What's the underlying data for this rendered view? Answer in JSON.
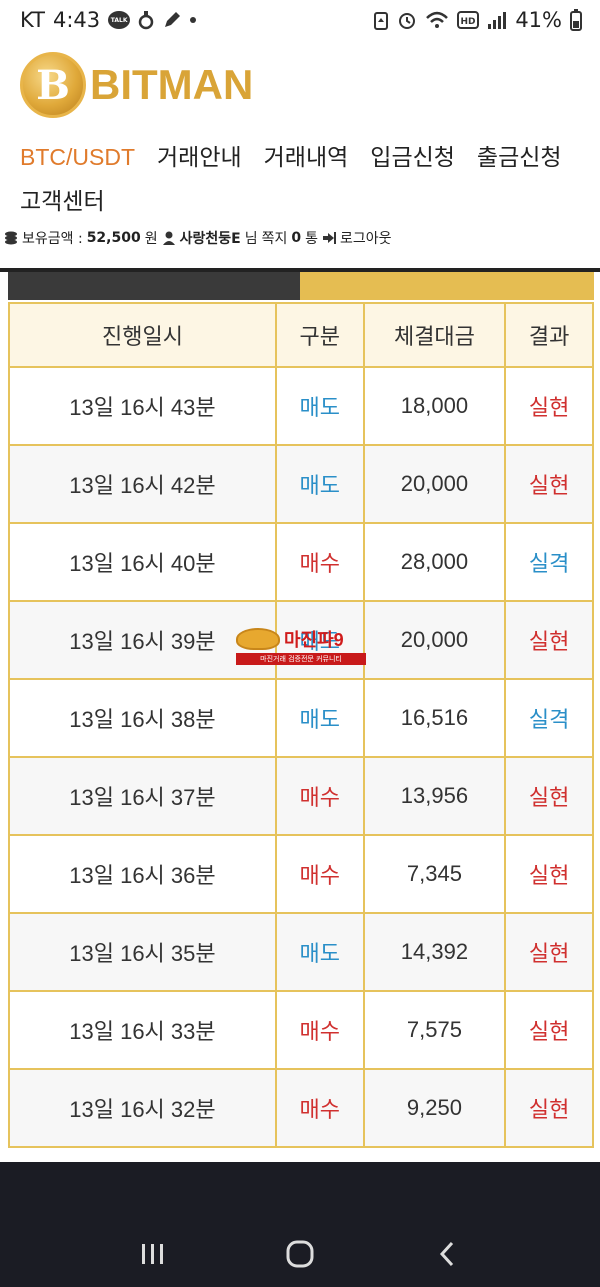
{
  "status_bar": {
    "carrier": "KT",
    "time": "4:43",
    "talk_badge": "TALK",
    "battery_percent": "41%"
  },
  "brand": {
    "coin_letter": "B",
    "name": "BITMAN"
  },
  "nav": {
    "items": [
      {
        "label": "BTC/USDT",
        "active": true
      },
      {
        "label": "거래안내",
        "active": false
      },
      {
        "label": "거래내역",
        "active": false
      },
      {
        "label": "입금신청",
        "active": false
      },
      {
        "label": "출금신청",
        "active": false
      },
      {
        "label": "고객센터",
        "active": false
      }
    ]
  },
  "user_bar": {
    "balance_label": "보유금액 :",
    "balance_value": "52,500",
    "balance_unit": "원",
    "username": "사랑천둥E",
    "honorific": "님",
    "messages_label": "쪽지",
    "messages_count": "0",
    "messages_unit": "통",
    "logout_label": "로그아웃"
  },
  "table": {
    "headers": [
      "진행일시",
      "구분",
      "체결대금",
      "결과"
    ],
    "rows": [
      {
        "time": "13일 16시 43분",
        "type": "매도",
        "amount": "18,000",
        "result": "실현"
      },
      {
        "time": "13일 16시 42분",
        "type": "매도",
        "amount": "20,000",
        "result": "실현"
      },
      {
        "time": "13일 16시 40분",
        "type": "매수",
        "amount": "28,000",
        "result": "실격"
      },
      {
        "time": "13일 16시 39분",
        "type": "매도",
        "amount": "20,000",
        "result": "실현"
      },
      {
        "time": "13일 16시 38분",
        "type": "매도",
        "amount": "16,516",
        "result": "실격"
      },
      {
        "time": "13일 16시 37분",
        "type": "매수",
        "amount": "13,956",
        "result": "실현"
      },
      {
        "time": "13일 16시 36분",
        "type": "매수",
        "amount": "7,345",
        "result": "실현"
      },
      {
        "time": "13일 16시 35분",
        "type": "매도",
        "amount": "14,392",
        "result": "실현"
      },
      {
        "time": "13일 16시 33분",
        "type": "매수",
        "amount": "7,575",
        "result": "실현"
      },
      {
        "time": "13일 16시 32분",
        "type": "매수",
        "amount": "9,250",
        "result": "실현"
      }
    ]
  },
  "colors": {
    "accent_orange": "#e07b2c",
    "gold": "#e5bd52",
    "sell_blue": "#2a8fc8",
    "buy_red": "#d0302f",
    "realized_red": "#d0302f",
    "failed_blue": "#2a8fc8"
  },
  "watermark": {
    "title": "마진파9",
    "subtitle": "마진거래 검증전문 커뮤니티"
  }
}
